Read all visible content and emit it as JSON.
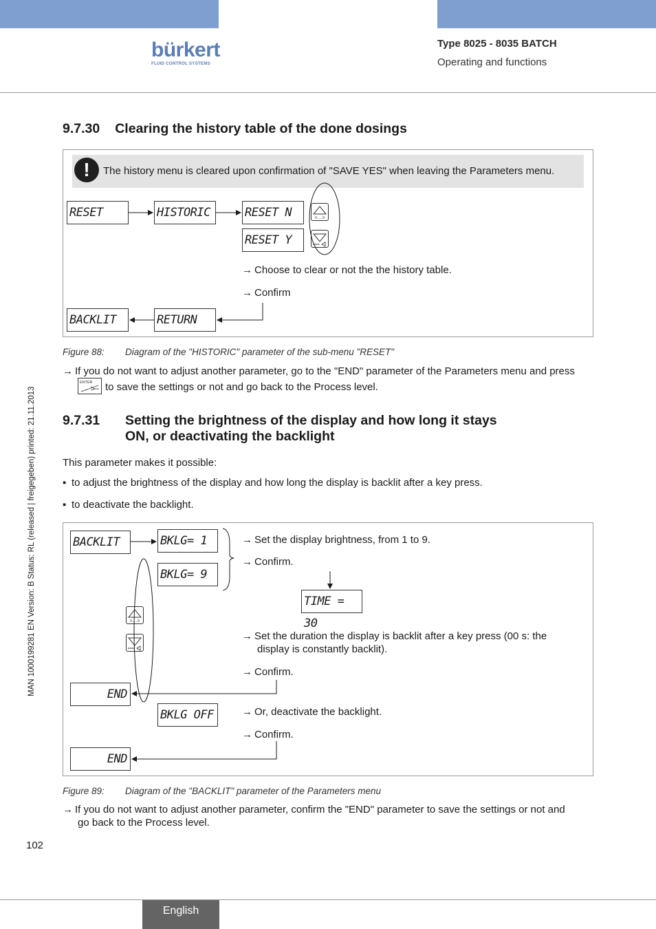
{
  "header": {
    "brand_name": "bürkert",
    "brand_tagline": "FLUID CONTROL SYSTEMS",
    "doc_type": "Type 8025 - 8035 BATCH",
    "doc_subtitle": "Operating and functions",
    "bar_color": "#7e9fcf"
  },
  "sidebar": {
    "print_info": "MAN  1000199281  EN  Version: B  Status: RL (released | freigegeben)  printed: 21.11.2013"
  },
  "section_1": {
    "number": "9.7.30",
    "title": "Clearing the history table of the done dosings",
    "warning": "The history menu is cleared upon confirmation of \"SAVE YES\" when leaving the Parameters menu.",
    "diagram": {
      "lcd_reset": "RESET",
      "lcd_historic": "HISTORIC",
      "lcd_reset_n": "RESET N",
      "lcd_reset_y": "RESET Y",
      "lcd_backlit": "BACKLIT",
      "lcd_return": "RETURN",
      "key_up_label": "0......9",
      "note_choose": "Choose to clear or not the the history table.",
      "note_confirm": "Confirm"
    },
    "figure_label": "Figure 88:",
    "figure_caption": "Diagram of the \"HISTORIC\" parameter of the sub-menu \"RESET\"",
    "instruction_line1": "If you do not want to adjust another parameter, go to the \"END\" parameter of the Parameters menu and press",
    "instruction_line2": "to save the settings or not and go back to the Process level.",
    "enter_key_label": "ENTER"
  },
  "section_2": {
    "number": "9.7.31",
    "title_line1": "Setting the brightness of the display and how long it stays",
    "title_line2": "ON, or deactivating the backlight",
    "intro": "This parameter makes it possible:",
    "bullets": [
      "to adjust the brightness of the display and how long the display is backlit after a key press.",
      "to deactivate the backlight."
    ],
    "diagram": {
      "lcd_backlit": "BACKLIT",
      "lcd_bklg1": "BKLG= 1",
      "lcd_bklg9": "BKLG= 9",
      "lcd_time": "TIME = 30",
      "lcd_end_1": "END",
      "lcd_bklg_off": "BKLG OFF",
      "lcd_end_2": "END",
      "key_up_label": "0......9",
      "note_brightness": "Set the display brightness, from 1 to 9.",
      "note_confirm_1": "Confirm.",
      "note_duration_line1": "Set the duration the display is backlit after a key press (00 s: the",
      "note_duration_line2": "display is constantly backlit).",
      "note_confirm_2": "Confirm.",
      "note_deactivate": "Or, deactivate the backlight.",
      "note_confirm_3": "Confirm."
    },
    "figure_label": "Figure 89:",
    "figure_caption": "Diagram of the \"BACKLIT\" parameter of the Parameters menu",
    "instruction_line1": "If you do not want to adjust another parameter, confirm the \"END\" parameter to save the settings or not and",
    "instruction_line2": "go back to the Process level."
  },
  "footer": {
    "page_number": "102",
    "language": "English"
  }
}
